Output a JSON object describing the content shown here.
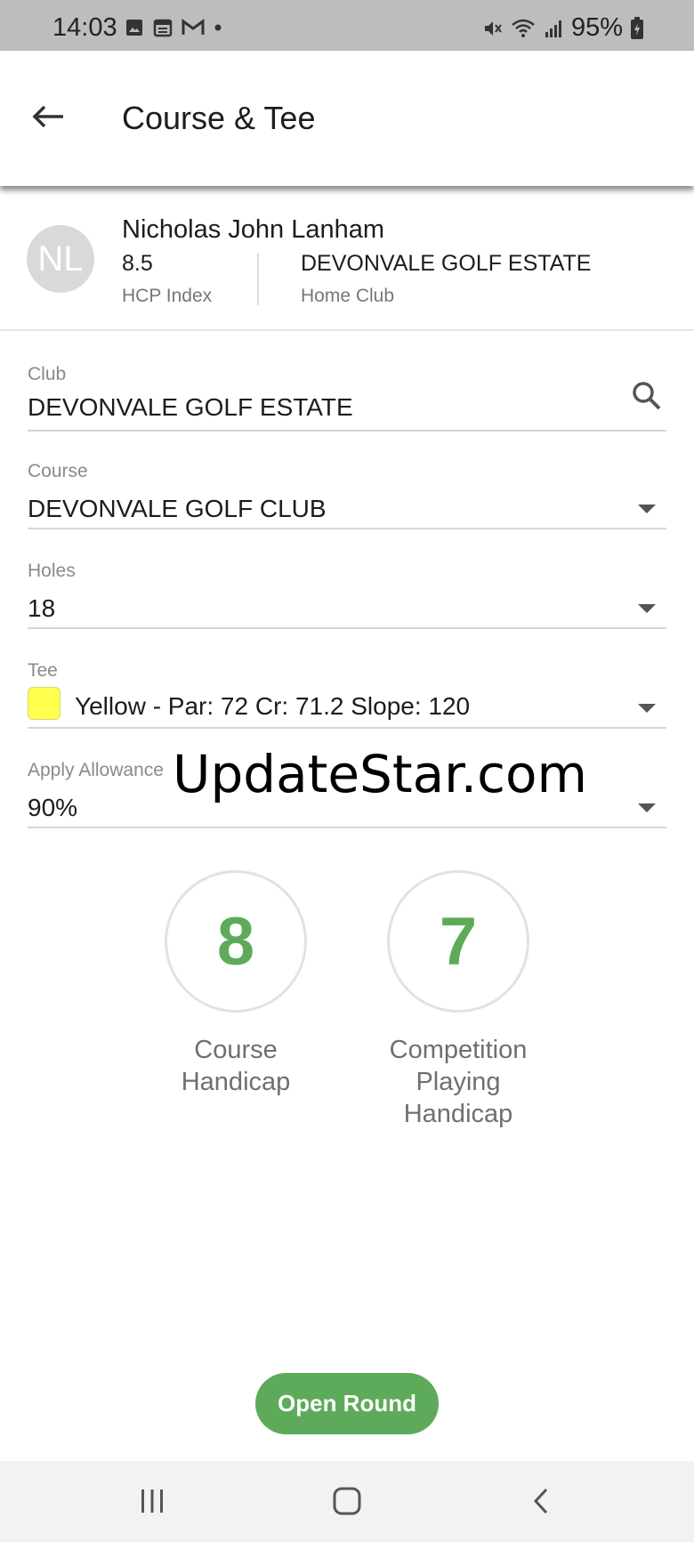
{
  "status_bar": {
    "time": "14:03",
    "battery": "95%"
  },
  "app_bar": {
    "title": "Course & Tee"
  },
  "profile": {
    "initials": "NL",
    "name": "Nicholas John Lanham",
    "hcp_value": "8.5",
    "hcp_label": "HCP Index",
    "home_club_value": "DEVONVALE GOLF ESTATE",
    "home_club_label": "Home Club"
  },
  "fields": {
    "club": {
      "label": "Club",
      "value": "DEVONVALE GOLF ESTATE"
    },
    "course": {
      "label": "Course",
      "value": "DEVONVALE GOLF CLUB"
    },
    "holes": {
      "label": "Holes",
      "value": "18"
    },
    "tee": {
      "label": "Tee",
      "value": "Yellow - Par: 72 Cr: 71.2 Slope: 120",
      "swatch_color": "#ffff4d"
    },
    "allowance": {
      "label": "Apply Allowance",
      "value": "90%"
    }
  },
  "watermark": "UpdateStar.com",
  "handicaps": {
    "course": {
      "value": "8",
      "caption_line1": "Course",
      "caption_line2": "Handicap"
    },
    "competition": {
      "value": "7",
      "caption_line1": "Competition",
      "caption_line2": "Playing",
      "caption_line3": "Handicap"
    }
  },
  "actions": {
    "open_round_label": "Open Round"
  },
  "colors": {
    "accent_green": "#5dab5a",
    "status_bar": "#bdbdbd"
  }
}
